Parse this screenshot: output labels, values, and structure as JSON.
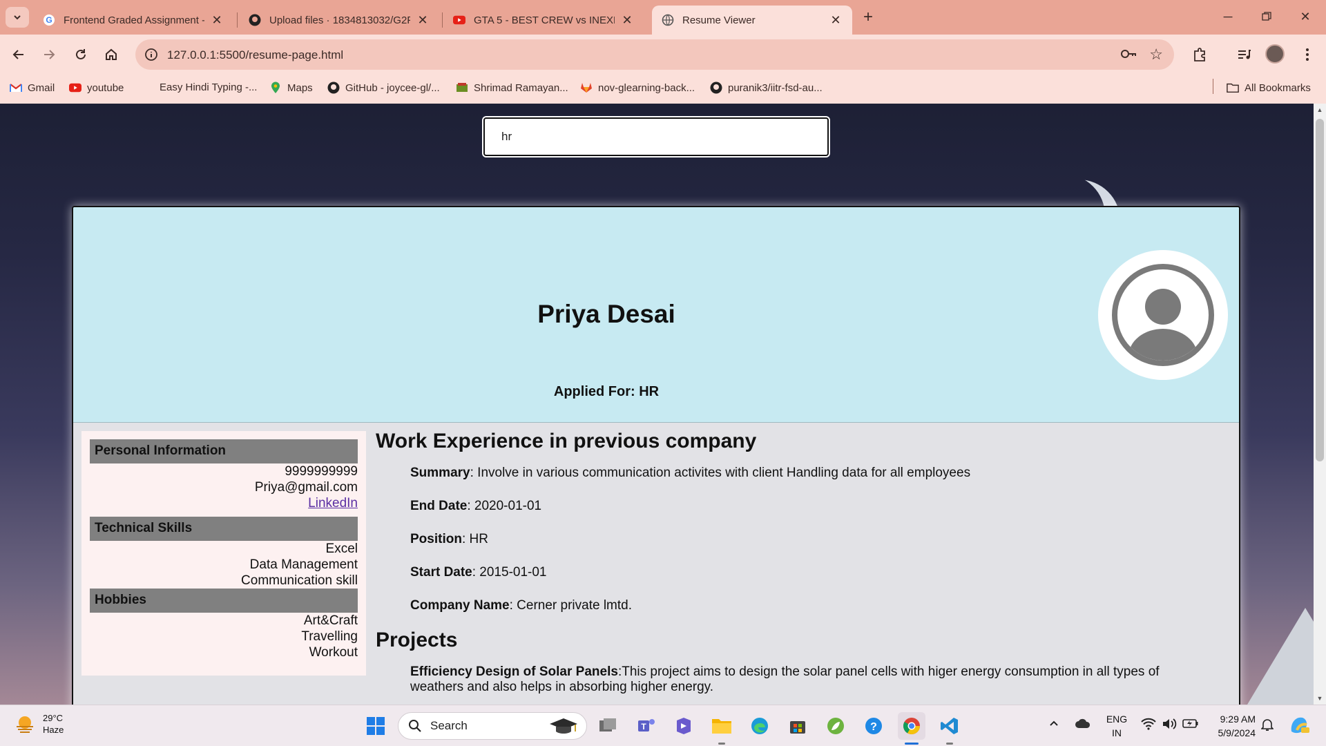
{
  "browser": {
    "tabs": [
      {
        "title": "Frontend Graded Assignment -",
        "favicon": "google-icon"
      },
      {
        "title": "Upload files · 1834813032/G2F5",
        "favicon": "github-icon"
      },
      {
        "title": "GTA 5 - BEST CREW vs INEXPER",
        "favicon": "youtube-icon"
      },
      {
        "title": "Resume Viewer",
        "favicon": "globe-icon"
      }
    ],
    "url": "127.0.0.1:5500/resume-page.html",
    "bookmarks": [
      {
        "label": "Gmail",
        "icon": "gmail-icon"
      },
      {
        "label": "youtube",
        "icon": "youtube-icon"
      },
      {
        "label": "Easy Hindi Typing -...",
        "icon": "none"
      },
      {
        "label": "Maps",
        "icon": "maps-icon"
      },
      {
        "label": "GitHub - joycee-gl/...",
        "icon": "github-icon"
      },
      {
        "label": "Shrimad Ramayan...",
        "icon": "book-icon"
      },
      {
        "label": "nov-glearning-back...",
        "icon": "gitlab-icon"
      },
      {
        "label": "puranik3/iitr-fsd-au...",
        "icon": "github-icon"
      }
    ],
    "all_bookmarks": "All Bookmarks"
  },
  "page": {
    "search_value": "hr",
    "candidate": {
      "name": "Priya Desai",
      "applied_label": "Applied For:",
      "applied_value": "HR"
    },
    "sidebar": {
      "personal_title": "Personal Information",
      "phone": "9999999999",
      "email": "Priya@gmail.com",
      "linkedin": "LinkedIn",
      "skills_title": "Technical Skills",
      "skills": [
        "Excel",
        "Data Management",
        "Communication skill"
      ],
      "hobbies_title": "Hobbies",
      "hobbies": [
        "Art&Craft",
        "Travelling",
        "Workout"
      ]
    },
    "work": {
      "title": "Work Experience in previous company",
      "rows": [
        {
          "label": "Summary",
          "value": ": Involve in various communication activites with client Handling data for all employees"
        },
        {
          "label": "End Date",
          "value": ": 2020-01-01"
        },
        {
          "label": "Position",
          "value": ": HR"
        },
        {
          "label": "Start Date",
          "value": ": 2015-01-01"
        },
        {
          "label": "Company Name",
          "value": ": Cerner private lmtd."
        }
      ]
    },
    "projects": {
      "title": "Projects",
      "items": [
        {
          "label": "Efficiency Design of Solar Panels",
          "value": ":This project aims to design the solar panel cells with higer energy consumption in all types of weathers and also helps in absorbing higher energy."
        }
      ]
    }
  },
  "taskbar": {
    "weather_temp": "29°C",
    "weather_desc": "Haze",
    "search_placeholder": "Search",
    "lang_top": "ENG",
    "lang_bottom": "IN",
    "time": "9:29 AM",
    "date": "5/9/2024"
  },
  "colors": {
    "tabbar": "#e9a595",
    "toolbar": "#fbe0da",
    "card_header": "#c7eaf2",
    "section_header": "#808080",
    "sidebar_bg": "#fdf1f1"
  }
}
